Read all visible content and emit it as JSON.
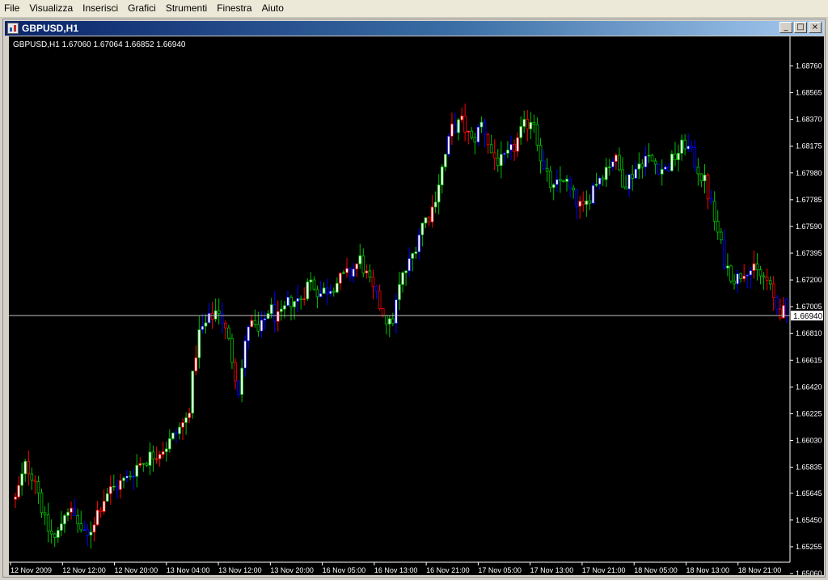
{
  "menu": [
    "File",
    "Visualizza",
    "Inserisci",
    "Grafici",
    "Strumenti",
    "Finestra",
    "Aiuto"
  ],
  "window": {
    "title": "GBPUSD,H1",
    "minimize_label": "_",
    "maximize_label": "□",
    "close_label": "×"
  },
  "chart_header": "GBPUSD,H1  1.67060 1.67064 1.66852 1.66940",
  "current_price_label": "1.66940",
  "colors": {
    "background": "#000000",
    "bull_body": "#ffffff",
    "bear_body": "#000000",
    "bull_wick": "#00c000",
    "bear_wick": "#ff0000",
    "neutral_wick": "#0000ff",
    "axis_text": "#ffffff",
    "price_line": "#c0c0c0"
  },
  "chart_data": {
    "type": "candlestick",
    "symbol": "GBPUSD",
    "timeframe": "H1",
    "ylim": [
      1.6506,
      1.6894
    ],
    "y_ticks": [
      "1.68760",
      "1.68565",
      "1.68370",
      "1.68175",
      "1.67980",
      "1.67785",
      "1.67590",
      "1.67395",
      "1.67200",
      "1.67005",
      "1.66810",
      "1.66615",
      "1.66420",
      "1.66225",
      "1.66030",
      "1.65835",
      "1.65645",
      "1.65450",
      "1.65255",
      "1.65060"
    ],
    "x_ticks": [
      "12 Nov 2009",
      "12 Nov 12:00",
      "12 Nov 20:00",
      "13 Nov 04:00",
      "13 Nov 12:00",
      "13 Nov 20:00",
      "16 Nov 05:00",
      "16 Nov 13:00",
      "16 Nov 21:00",
      "17 Nov 05:00",
      "17 Nov 13:00",
      "17 Nov 21:00",
      "18 Nov 05:00",
      "18 Nov 13:00",
      "18 Nov 21:00"
    ],
    "current_price": 1.6694,
    "last_bar": {
      "open": 1.6706,
      "high": 1.67064,
      "low": 1.66852,
      "close": 1.6694
    },
    "close_path": [
      1.656,
      1.6585,
      1.6575,
      1.654,
      1.653,
      1.6555,
      1.6545,
      1.653,
      1.655,
      1.6565,
      1.657,
      1.6575,
      1.6585,
      1.659,
      1.6595,
      1.66,
      1.661,
      1.662,
      1.668,
      1.669,
      1.67,
      1.6675,
      1.664,
      1.669,
      1.668,
      1.67,
      1.669,
      1.6705,
      1.6705,
      1.672,
      1.671,
      1.6715,
      1.672,
      1.6725,
      1.6735,
      1.6715,
      1.67,
      1.6685,
      1.672,
      1.6735,
      1.676,
      1.677,
      1.68,
      1.683,
      1.6835,
      1.682,
      1.6835,
      1.681,
      1.6805,
      1.6815,
      1.683,
      1.684,
      1.68,
      1.6785,
      1.6795,
      1.678,
      1.677,
      1.679,
      1.68,
      1.681,
      1.679,
      1.68,
      1.681,
      1.6805,
      1.68,
      1.681,
      1.682,
      1.6805,
      1.679,
      1.676,
      1.673,
      1.672,
      1.673,
      1.6725,
      1.672,
      1.67,
      1.6694
    ]
  }
}
